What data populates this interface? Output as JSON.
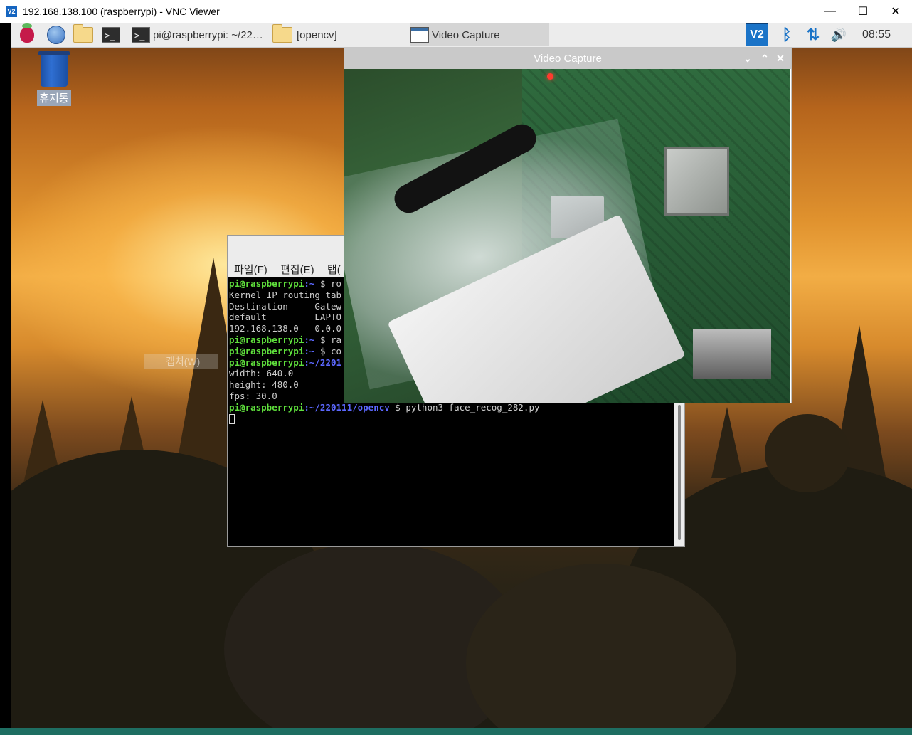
{
  "vnc_window": {
    "logo_text": "V2",
    "title": "192.168.138.100 (raspberrypi) - VNC Viewer",
    "minimize_glyph": "—",
    "maximize_glyph": "☐",
    "close_glyph": "✕"
  },
  "panel": {
    "tasks": [
      {
        "label": "pi@raspberrypi: ~/22…",
        "icon": "terminal-icon"
      },
      {
        "label": "[opencv]",
        "icon": "folder-icon"
      },
      {
        "label": "Video Capture",
        "icon": "window-icon",
        "active": true
      }
    ],
    "tray": {
      "vnc_text": "V2",
      "bluetooth_glyph": "ᛒ",
      "network_glyph": "⇅",
      "volume_glyph": "🔊",
      "clock": "08:55"
    },
    "terminal_glyph": ">_"
  },
  "desktop": {
    "trash_label": "휴지통",
    "ghost_text": "캡처(W)"
  },
  "terminal": {
    "menu": [
      "파일(F)",
      "편집(E)",
      "탭("
    ],
    "lines": [
      {
        "user": "pi@raspberrypi",
        "path": ":~",
        "rest": " $ ro"
      },
      {
        "text": "Kernel IP routing tab"
      },
      {
        "text": "Destination     Gatew"
      },
      {
        "text": "default         LAPTO"
      },
      {
        "text": "192.168.138.0   0.0.0"
      },
      {
        "user": "pi@raspberrypi",
        "path": ":~",
        "rest": " $ ra"
      },
      {
        "user": "pi@raspberrypi",
        "path": ":~",
        "rest": " $ co"
      },
      {
        "user": "pi@raspberrypi",
        "path": ":~/2201",
        "rest": ""
      },
      {
        "text": "width: 640.0"
      },
      {
        "text": "height: 480.0"
      },
      {
        "text": "fps: 30.0"
      },
      {
        "user": "pi@raspberrypi",
        "path": ":~/220111/opencv",
        "rest": " $ python3 face_recog_282.py"
      }
    ]
  },
  "video_capture": {
    "title": "Video Capture",
    "btn_min": "⌄",
    "btn_max": "⌃",
    "btn_close": "✕"
  }
}
